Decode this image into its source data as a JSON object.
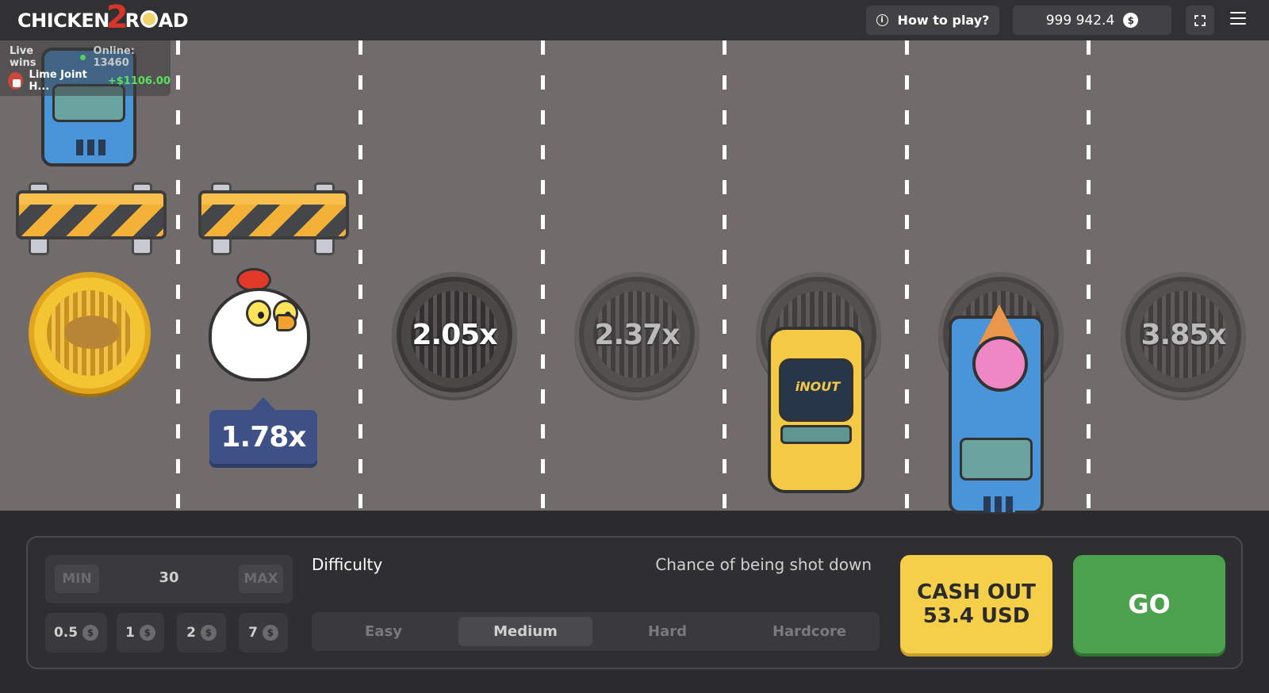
{
  "header": {
    "logo_left": "CHICKEN",
    "logo_two": "2",
    "logo_right_a": "R",
    "logo_right_b": "AD",
    "how_to_play": "How to play?",
    "balance": "999 942.4",
    "currency_symbol": "$"
  },
  "live": {
    "title": "Live wins",
    "online": "Online: 13460",
    "winner_name": "Lime Joint H...",
    "winner_amount": "+$1106.00"
  },
  "road": {
    "current_multiplier": "1.78x",
    "lanes": [
      {
        "multiplier": "2.05x"
      },
      {
        "multiplier": "2.37x"
      },
      {
        "multiplier": "3.85x"
      }
    ],
    "taxi_sign": "iNOUT"
  },
  "bet": {
    "min_label": "MIN",
    "max_label": "MAX",
    "amount": "30",
    "chips": [
      "0.5",
      "1",
      "2",
      "7"
    ],
    "currency_symbol": "$"
  },
  "difficulty": {
    "label": "Difficulty",
    "chance_label": "Chance of being shot down",
    "options": [
      "Easy",
      "Medium",
      "Hard",
      "Hardcore"
    ],
    "selected": "Medium"
  },
  "actions": {
    "cashout_line1": "CASH OUT",
    "cashout_line2": "53.4 USD",
    "go": "GO"
  },
  "colors": {
    "road": "#716c6b",
    "cashout": "#f6cf4a",
    "go": "#4ca14f",
    "win_green": "#5ee05e",
    "multiplier_tag": "#3e5186"
  }
}
